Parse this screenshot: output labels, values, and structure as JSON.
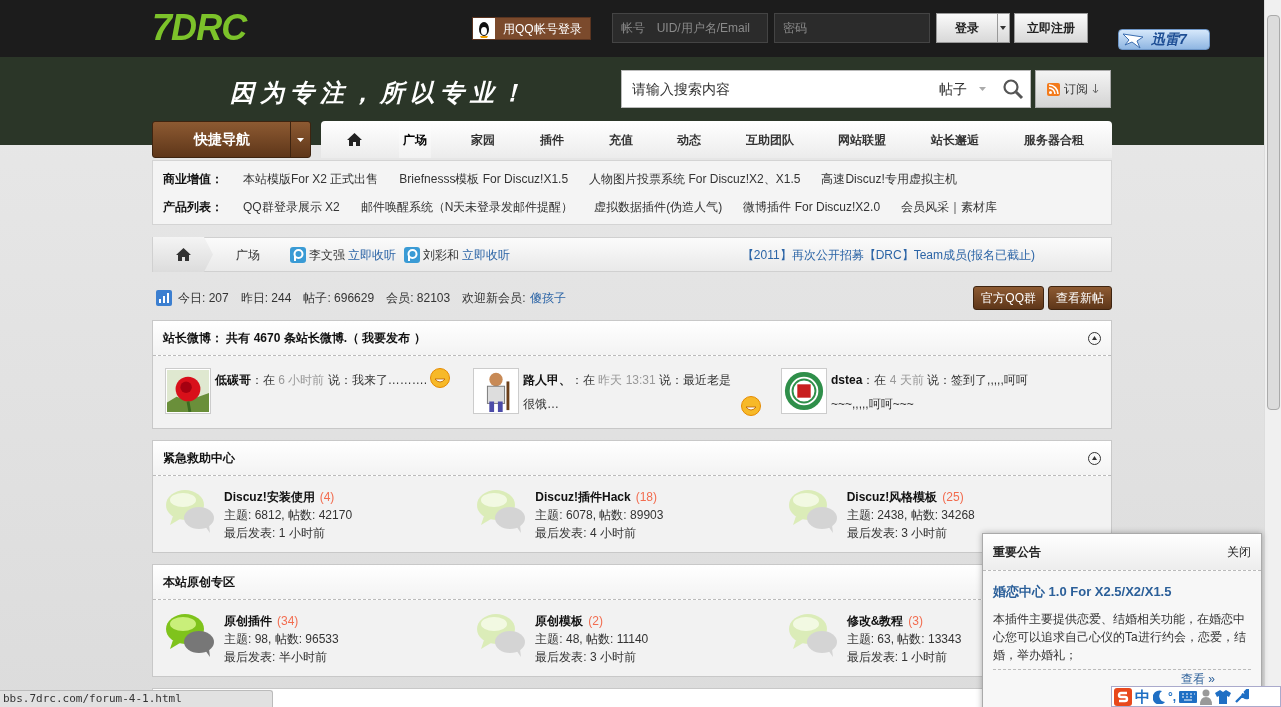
{
  "header": {
    "logo": "7DRC",
    "qq_login": "用QQ帐号登录",
    "username_placeholder": "帐号　UID/用户名/Email",
    "password_placeholder": "密码",
    "login": "登录",
    "register": "立即注册",
    "badge": "迅雷7"
  },
  "banner": {
    "slogan": "因为专注，所以专业！",
    "search_placeholder": "请输入搜索内容",
    "search_type": "帖子",
    "subscribe": "订阅"
  },
  "quick_nav": "快捷导航",
  "nav": [
    {
      "label": "广场",
      "selected": true
    },
    {
      "label": "家园",
      "selected": false
    },
    {
      "label": "插件",
      "selected": false
    },
    {
      "label": "充值",
      "selected": false
    },
    {
      "label": "动态",
      "selected": false
    },
    {
      "label": "互助团队",
      "selected": false
    },
    {
      "label": "网站联盟",
      "selected": false
    },
    {
      "label": "站长邂逅",
      "selected": false
    },
    {
      "label": "服务器合租",
      "selected": false
    }
  ],
  "link_rows": [
    {
      "label": "商业增值：",
      "links": [
        "本站模版For X2 正式出售",
        "Briefnesss模板 For Discuz!X1.5",
        "人物图片投票系统 For Discuz!X2、X1.5",
        "高速Discuz!专用虚拟主机"
      ]
    },
    {
      "label": "产品列表：",
      "links": [
        "QQ群登录展示 X2",
        "邮件唤醒系统（N天未登录发邮件提醒）",
        "虚拟数据插件(伪造人气)",
        "微博插件 For Discuz!X2.0",
        "会员风采｜素材库"
      ]
    }
  ],
  "breadcrumb": {
    "current": "广场",
    "listen": [
      {
        "name": "李文强",
        "action": "立即收听"
      },
      {
        "name": "刘彩和",
        "action": "立即收听"
      }
    ],
    "notice": "【2011】再次公开招募【DRC】Team成员(报名已截止)"
  },
  "stats": [
    {
      "label": "今日:",
      "value": "207"
    },
    {
      "label": "昨日:",
      "value": "244"
    },
    {
      "label": "帖子:",
      "value": "696629"
    },
    {
      "label": "会员:",
      "value": "82103"
    }
  ],
  "new_member": {
    "label": "欢迎新会员:",
    "name": "傻孩子"
  },
  "action_buttons": [
    "官方QQ群",
    "查看新帖"
  ],
  "weibo": {
    "title": "站长微博： 共有 4670 条站长微博.（ 我要发布 ）",
    "posts": [
      {
        "user": "低碳哥",
        "at": "：在",
        "time": "6 小时前",
        "said": "说：",
        "text": "我来了……….",
        "kind": "picture"
      },
      {
        "user": "路人甲、",
        "at": "：在",
        "time": "昨天 13:31",
        "said": "说：",
        "text": "最近老是很饿…",
        "kind": "picture"
      },
      {
        "user": "dstea",
        "at": "：在",
        "time": "4 天前",
        "said": "说：",
        "text": "签到了,,,,,呵呵~~~,,,,,呵呵~~~",
        "kind": "picture"
      }
    ]
  },
  "sections": [
    {
      "title": "紧急救助中心",
      "collapse_icon": true,
      "forums": [
        {
          "name": "Discuz!安装使用",
          "count": "(4)",
          "stats": "主题: 6812, 帖数: 42170",
          "last": "最后发表: 1 小时前",
          "has_new": false
        },
        {
          "name": "Discuz!插件Hack",
          "count": "(18)",
          "stats": "主题: 6078, 帖数: 89903",
          "last": "最后发表: 4 小时前",
          "has_new": false
        },
        {
          "name": "Discuz!风格模板",
          "count": "(25)",
          "stats": "主题: 2438, 帖数: 34268",
          "last": "最后发表: 3 小时前",
          "has_new": false
        }
      ]
    },
    {
      "title": "本站原创专区",
      "collapse_icon": false,
      "forums": [
        {
          "name": "原创插件",
          "count": "(34)",
          "stats": "主题: 98, 帖数: 96533",
          "last": "最后发表: 半小时前",
          "has_new": true
        },
        {
          "name": "原创模板",
          "count": "(2)",
          "stats": "主题: 48, 帖数: 11140",
          "last": "最后发表: 3 小时前",
          "has_new": false
        },
        {
          "name": "修改&教程",
          "count": "(3)",
          "stats": "主题: 63, 帖数: 13343",
          "last": "最后发表: 1 小时前",
          "has_new": false
        }
      ]
    }
  ],
  "popup": {
    "title": "重要公告",
    "close": "关闭",
    "headline": "婚恋中心 1.0 For X2.5/X2/X1.5",
    "body": "本插件主要提供恋爱、结婚相关功能，在婚恋中心您可以追求自己心仪的Ta进行约会，恋爱，结婚，举办婚礼；",
    "more": "查看 »"
  },
  "ime": {
    "mode": "中",
    "punct": "°,"
  },
  "status_bar": "bbs.7drc.com/forum-4-1.html"
}
